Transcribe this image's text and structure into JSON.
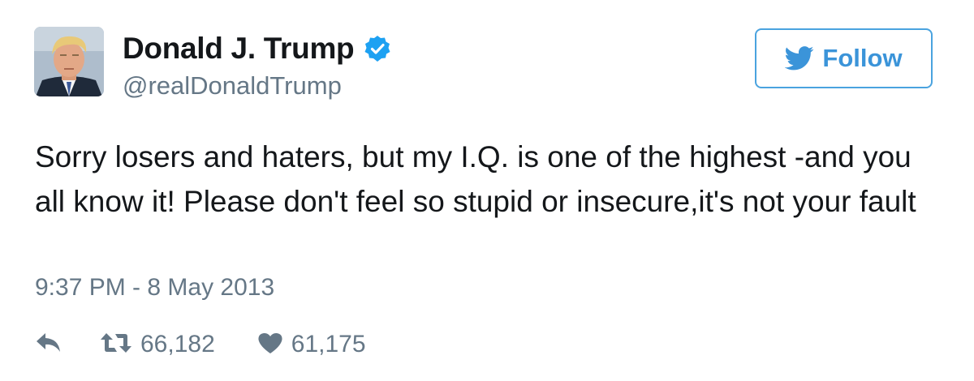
{
  "user": {
    "display_name": "Donald J. Trump",
    "handle": "@realDonaldTrump",
    "verified": true
  },
  "follow_button": {
    "label": "Follow",
    "icon": "twitter-bird-icon"
  },
  "tweet": {
    "text": "Sorry losers and haters, but my I.Q. is one of the highest -and you all know it! Please don't feel so stupid or insecure,it's not your fault",
    "timestamp": "9:37 PM - 8 May 2013"
  },
  "actions": {
    "reply": {
      "icon": "reply-icon"
    },
    "retweet": {
      "icon": "retweet-icon",
      "count": "66,182"
    },
    "like": {
      "icon": "heart-icon",
      "count": "61,175"
    }
  },
  "colors": {
    "accent": "#3b94d9",
    "verified": "#1da1f2",
    "secondary_text": "#657786",
    "primary_text": "#14171a"
  }
}
